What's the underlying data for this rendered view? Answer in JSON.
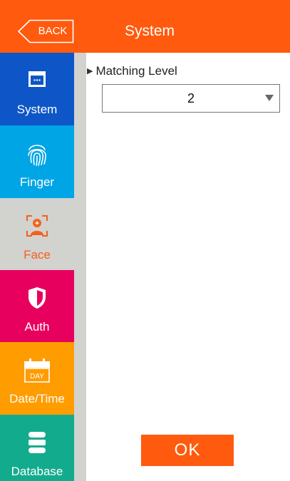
{
  "header": {
    "back_label": "BACK",
    "title": "System"
  },
  "sidebar": {
    "items": [
      {
        "label": "System",
        "icon": "window-icon",
        "color": "#0e56c7"
      },
      {
        "label": "Finger",
        "icon": "fingerprint-icon",
        "color": "#00a5e5"
      },
      {
        "label": "Face",
        "icon": "face-icon",
        "color": "#f4601a",
        "selected": true
      },
      {
        "label": "Auth",
        "icon": "shield-icon",
        "color": "#e8005f"
      },
      {
        "label": "Date/Time",
        "icon": "calendar-icon",
        "color": "#ff9c00"
      },
      {
        "label": "Database",
        "icon": "database-icon",
        "color": "#13ab8e"
      }
    ]
  },
  "main": {
    "section_label": "Matching Level",
    "matching_level": {
      "selected": "2"
    },
    "ok_label": "OK"
  },
  "colors": {
    "accent": "#ff5a0e",
    "sidebar_bg": "#d2d2cf"
  },
  "calendar_text": "DAY"
}
